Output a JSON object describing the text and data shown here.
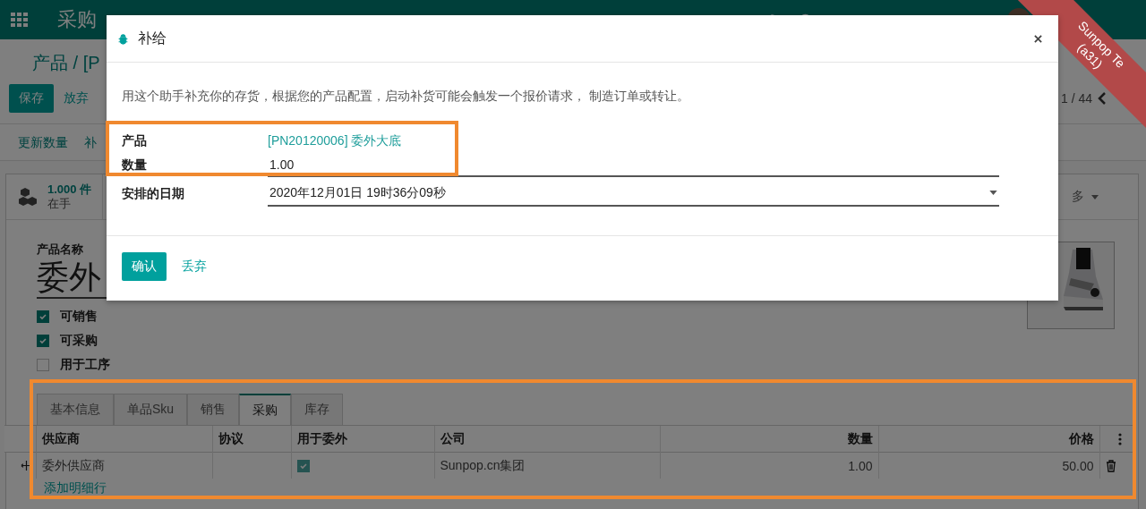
{
  "navbar": {
    "app_title": "采购"
  },
  "ribbon": {
    "lines": [
      "Sunpop Te",
      "(a31)"
    ]
  },
  "breadcrumb": "产品 / [P",
  "actions": [
    {
      "label": "保存",
      "kind": "primary"
    },
    {
      "label": "放弃",
      "kind": "link"
    }
  ],
  "pager": "1 / 44",
  "button_box": [
    "更新数量",
    "补"
  ],
  "stat": {
    "value": "1.000 件",
    "label": "在手"
  },
  "more": "多",
  "form": {
    "name_label": "产品名称",
    "name": "委外",
    "options": [
      {
        "label": "可销售",
        "checked": true
      },
      {
        "label": "可采购",
        "checked": true
      },
      {
        "label": "用于工序",
        "checked": false
      }
    ],
    "tabs": [
      {
        "label": "基本信息",
        "selected": false
      },
      {
        "label": "单品Sku",
        "selected": false
      },
      {
        "label": "销售",
        "selected": false
      },
      {
        "label": "采购",
        "selected": true
      },
      {
        "label": "库存",
        "selected": false
      }
    ],
    "table": {
      "columns": [
        {
          "label": "供应商",
          "kind": "text"
        },
        {
          "label": "协议",
          "kind": "text"
        },
        {
          "label": "用于委外",
          "kind": "text"
        },
        {
          "label": "公司",
          "kind": "text"
        },
        {
          "label": "数量",
          "kind": "number"
        },
        {
          "label": "价格",
          "kind": "number"
        }
      ],
      "rows": [
        {
          "cells": [
            {
              "kind": "text",
              "value": "委外供应商"
            },
            {
              "kind": "empty"
            },
            {
              "kind": "checkbox",
              "checked": true
            },
            {
              "kind": "text",
              "value": "Sunpop.cn集团"
            },
            {
              "kind": "number",
              "value": "1.00"
            },
            {
              "kind": "number",
              "value": "50.00"
            }
          ]
        }
      ],
      "add_line": "添加明细行"
    }
  },
  "dialog": {
    "title": "补给",
    "description": "用这个助手补充你的存货，根据您的产品配置，启动补货可能会触发一个报价请求， 制造订单或转让。",
    "fields": [
      {
        "label": "产品",
        "kind": "link",
        "value": "[PN20120006] 委外大底"
      },
      {
        "label": "数量",
        "kind": "input",
        "value": "1.00"
      },
      {
        "label": "安排的日期",
        "kind": "select",
        "value": "2020年12月01日 19时36分09秒"
      }
    ],
    "buttons": [
      {
        "label": "确认",
        "kind": "primary"
      },
      {
        "label": "丢弃",
        "kind": "link"
      }
    ]
  }
}
